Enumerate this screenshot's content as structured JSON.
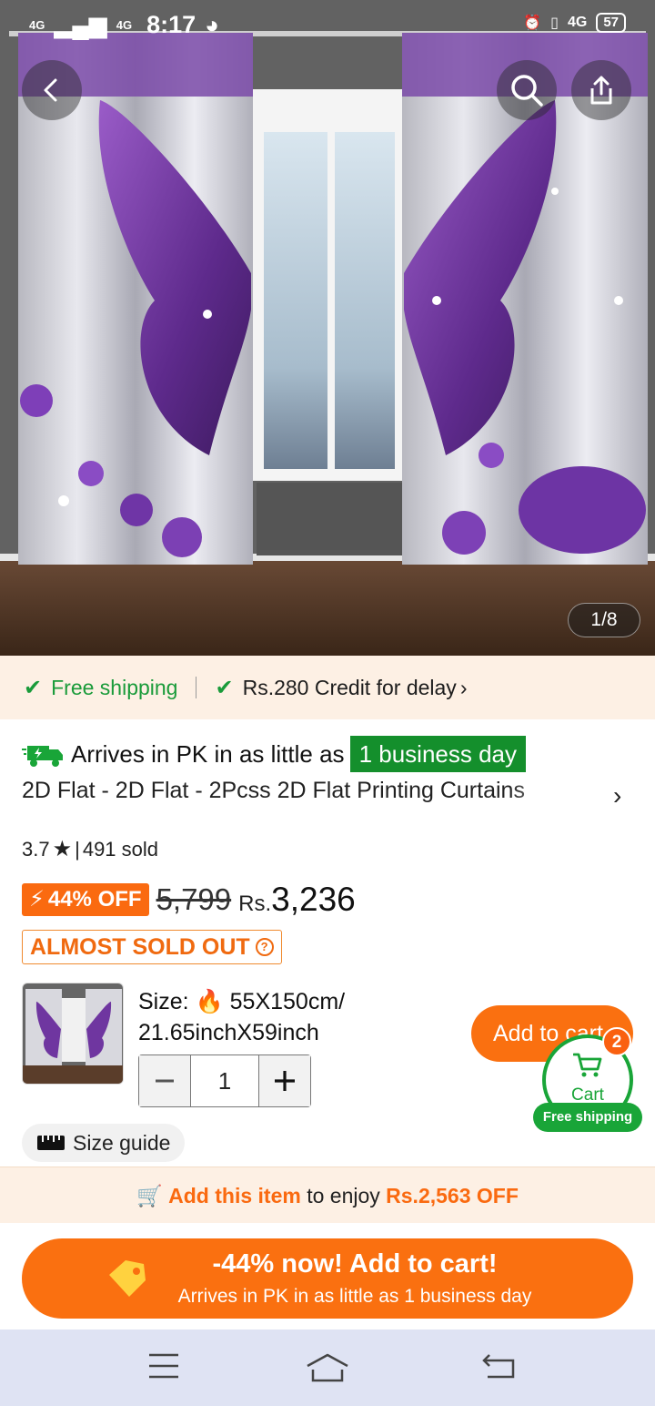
{
  "status_bar": {
    "network_1": "4G",
    "network_2": "4G",
    "time": "8:17",
    "mobile": "4G",
    "battery": "57"
  },
  "gallery": {
    "counter": "1/8"
  },
  "shipping": {
    "free_shipping": "Free shipping",
    "credit": "Rs.280 Credit for delay"
  },
  "delivery": {
    "arrives": "Arrives in PK in as little as",
    "badge": "1 business day"
  },
  "product": {
    "title": "2D Flat - 2D Flat - 2Pcss 2D Flat Printing Curtains",
    "rating": "3.7",
    "sold": "491 sold",
    "discount": "44% OFF",
    "old_price": "5,799",
    "currency": "Rs.",
    "price": "3,236",
    "stock_status": "ALMOST SOLD OUT"
  },
  "variant": {
    "size_label": "Size:",
    "size_value": "55X150cm/",
    "size_value_2": "21.65inchX59inch",
    "quantity": "1"
  },
  "actions": {
    "add_to_cart": "Add to cart",
    "cart_label": "Cart",
    "cart_count": "2",
    "cart_free_shipping": "Free shipping",
    "size_guide": "Size guide"
  },
  "promo": {
    "add_item": "Add this item",
    "to_enjoy": "to enjoy",
    "discount": "Rs.2,563 OFF"
  },
  "cta": {
    "main": "-44% now! Add to cart!",
    "sub": "Arrives in PK in as little as 1 business day"
  },
  "colors": {
    "accent_orange": "#fa7010",
    "green": "#19a538",
    "cream": "#fdf0e4"
  }
}
